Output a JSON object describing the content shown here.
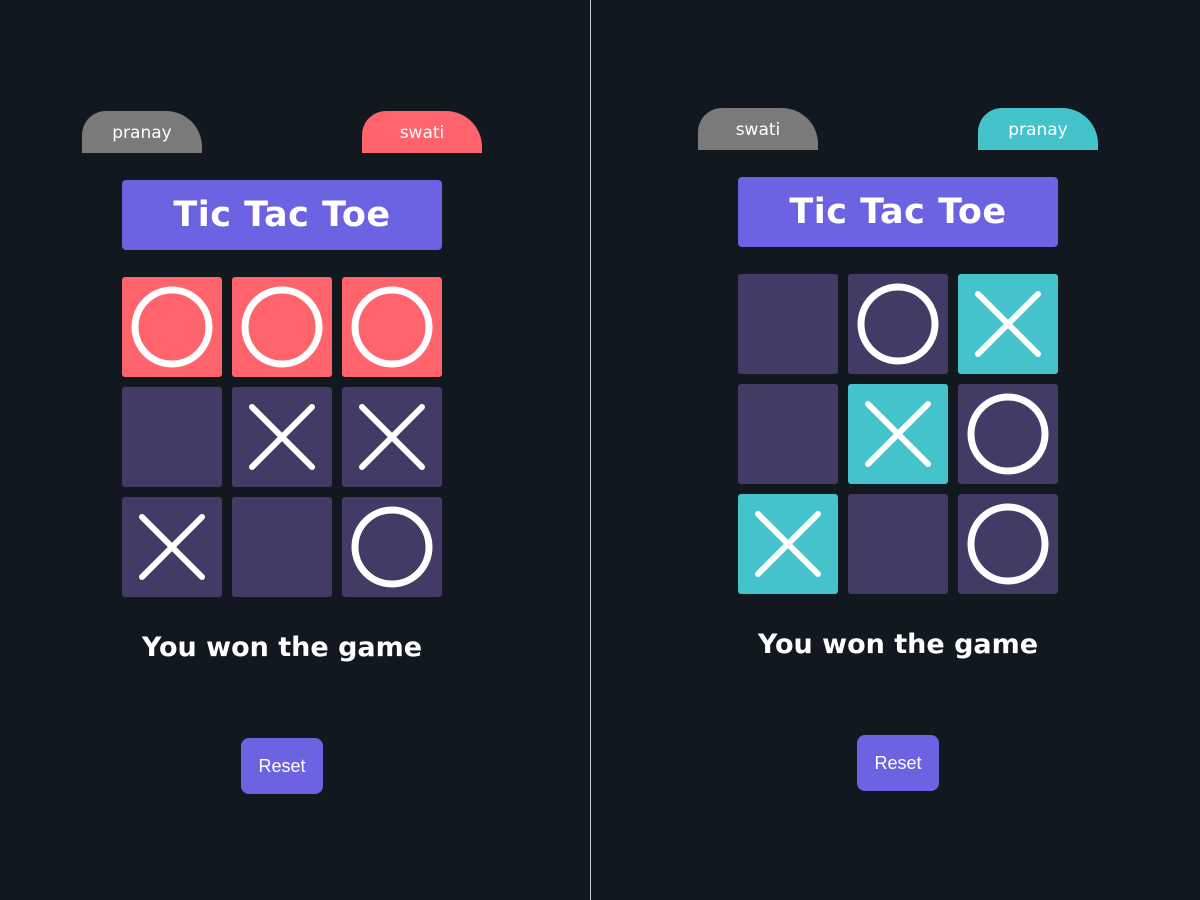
{
  "colors": {
    "background": "#111820",
    "accent": "#6c63e3",
    "cell_default": "#443a66",
    "tag_inactive": "#7a7a7a",
    "win_red": "#ff636b",
    "win_teal": "#45c3cb",
    "mark": "#ffffff"
  },
  "panels": [
    {
      "player_left": {
        "name": "pranay",
        "color": "#7a7a7a"
      },
      "player_right": {
        "name": "swati",
        "color": "#ff636b"
      },
      "title": "Tic Tac Toe",
      "win_color": "#ff636b",
      "board": [
        {
          "mark": "O",
          "winning": true
        },
        {
          "mark": "O",
          "winning": true
        },
        {
          "mark": "O",
          "winning": true
        },
        {
          "mark": "",
          "winning": false
        },
        {
          "mark": "X",
          "winning": false
        },
        {
          "mark": "X",
          "winning": false
        },
        {
          "mark": "X",
          "winning": false
        },
        {
          "mark": "",
          "winning": false
        },
        {
          "mark": "O",
          "winning": false
        }
      ],
      "status": "You won the game",
      "reset_label": "Reset"
    },
    {
      "player_left": {
        "name": "swati",
        "color": "#7a7a7a"
      },
      "player_right": {
        "name": "pranay",
        "color": "#45c3cb"
      },
      "title": "Tic Tac Toe",
      "win_color": "#45c3cb",
      "board": [
        {
          "mark": "",
          "winning": false
        },
        {
          "mark": "O",
          "winning": false
        },
        {
          "mark": "X",
          "winning": true
        },
        {
          "mark": "",
          "winning": false
        },
        {
          "mark": "X",
          "winning": true
        },
        {
          "mark": "O",
          "winning": false
        },
        {
          "mark": "X",
          "winning": true
        },
        {
          "mark": "",
          "winning": false
        },
        {
          "mark": "O",
          "winning": false
        }
      ],
      "status": "You won the game",
      "reset_label": "Reset"
    }
  ]
}
